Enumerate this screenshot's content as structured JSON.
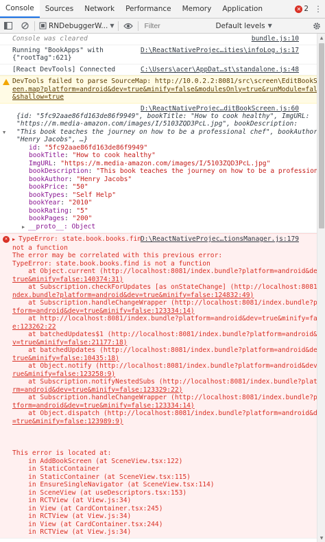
{
  "tabs": [
    "Console",
    "Sources",
    "Network",
    "Performance",
    "Memory",
    "Application"
  ],
  "error_count": "2",
  "toolbar": {
    "context": "RNDebuggerW...",
    "filter_placeholder": "Filter",
    "levels": "Default levels"
  },
  "messages": {
    "cleared": {
      "text": "Console was cleared",
      "src": "bundle.js:10"
    },
    "running": {
      "line1": "Running \"BookApps\" with",
      "line2": "{\"rootTag\":621}",
      "src": "D:\\ReactNativeProjec…ities\\infoLog.js:17"
    },
    "devtools": {
      "text": "[React DevTools] Connected",
      "src": "C:\\Users\\acer\\AppDat…st\\standalone.js:48"
    },
    "warn": {
      "line1": "DevTools failed to parse SourceMap: http://10.0.2.2:8081/src\\screen\\EditBookScr",
      "line2": "een.map?platform=android&dev=true&minify=false&modulesOnly=true&runModule=false",
      "line3": "&shallow=true"
    },
    "object": {
      "src": "D:\\ReactNativeProjec…ditBookScreen.js:60",
      "summary": [
        "{id: \"5fc92aae86fd163de86f9949\", bookTitle: \"How to cook healthy\", ImgURL:",
        "\"https://m.media-amazon.com/images/I/5103ZQD3PcL.jpg\", bookDescription:",
        "\"This book teaches the journey on how to be a professional chef\", bookAuthor:",
        "\"Henry Jacobs\", …}"
      ],
      "props": [
        {
          "key": "id",
          "value": "\"5fc92aae86fd163de86f9949\"",
          "kind": "str"
        },
        {
          "key": "bookTitle",
          "value": "\"How to cook healthy\"",
          "kind": "str"
        },
        {
          "key": "ImgURL",
          "value": "\"https://m.media-amazon.com/images/I/5103ZQD3PcL.jpg\"",
          "kind": "str"
        },
        {
          "key": "bookDescription",
          "value": "\"This book teaches the journey on how to be a professiona…",
          "kind": "str"
        },
        {
          "key": "bookAuthor",
          "value": "\"Henry Jacobs\"",
          "kind": "str"
        },
        {
          "key": "bookPrice",
          "value": "\"50\"",
          "kind": "str"
        },
        {
          "key": "bookTypes",
          "value": "\"Self Help\"",
          "kind": "str"
        },
        {
          "key": "bookYear",
          "value": "\"2010\"",
          "kind": "str"
        },
        {
          "key": "bookRating",
          "value": "\"5\"",
          "kind": "str"
        },
        {
          "key": "bookPages",
          "value": "\"200\"",
          "kind": "str"
        }
      ],
      "proto": "__proto__: Object"
    },
    "error1": {
      "line1": "TypeError: state.book.books.find is",
      "src": "D:\\ReactNativeProjec…tionsManager.js:179",
      "line2": "not a function",
      "line3": "The error may be correlated with this previous error:",
      "line4": "TypeError: state.book.books.find is not a function",
      "stack": [
        "    at Object.current (http://localhost:8081/index.bundle?platform=android&dev=",
        "true&minify=false:140374:31)",
        "    at Subscription.checkForUpdates [as onStateChange] (http://localhost:8081/i",
        "ndex.bundle?platform=android&dev=true&minify=false:124832:49)",
        "    at Subscription.handleChangeWrapper (http://localhost:8081/index.bundle?pla",
        "tform=android&dev=true&minify=false:123334:14)",
        "    at http://localhost:8081/index.bundle?platform=android&dev=true&minify=fals",
        "e:123262:22",
        "    at batchedUpdates$1 (http://localhost:8081/index.bundle?platform=android&de",
        "v=true&minify=false:21177:18)",
        "    at batchedUpdates (http://localhost:8081/index.bundle?platform=android&dev=",
        "true&minify=false:10435:18)",
        "    at Object.notify (http://localhost:8081/index.bundle?platform=android&dev=t",
        "rue&minify=false:123258:9)",
        "    at Subscription.notifyNestedSubs (http://localhost:8081/index.bundle?platfo",
        "rm=android&dev=true&minify=false:123329:22)",
        "    at Subscription.handleChangeWrapper (http://localhost:8081/index.bundle?pla",
        "tform=android&dev=true&minify=false:123334:14)",
        "    at Object.dispatch (http://localhost:8081/index.bundle?platform=android&dev",
        "=true&minify=false:123989:9)"
      ],
      "located_title": "This error is located at:",
      "located": [
        "    in AddBookScreen (at SceneView.tsx:122)",
        "    in StaticContainer",
        "    in StaticContainer (at SceneView.tsx:115)",
        "    in EnsureSingleNavigator (at SceneView.tsx:114)",
        "    in SceneView (at useDescriptors.tsx:153)",
        "    in RCTView (at View.js:34)",
        "    in View (at CardContainer.tsx:245)",
        "    in RCTView (at View.js:34)",
        "    in View (at CardContainer.tsx:244)",
        "    in RCTView (at View.js:34)"
      ]
    }
  }
}
